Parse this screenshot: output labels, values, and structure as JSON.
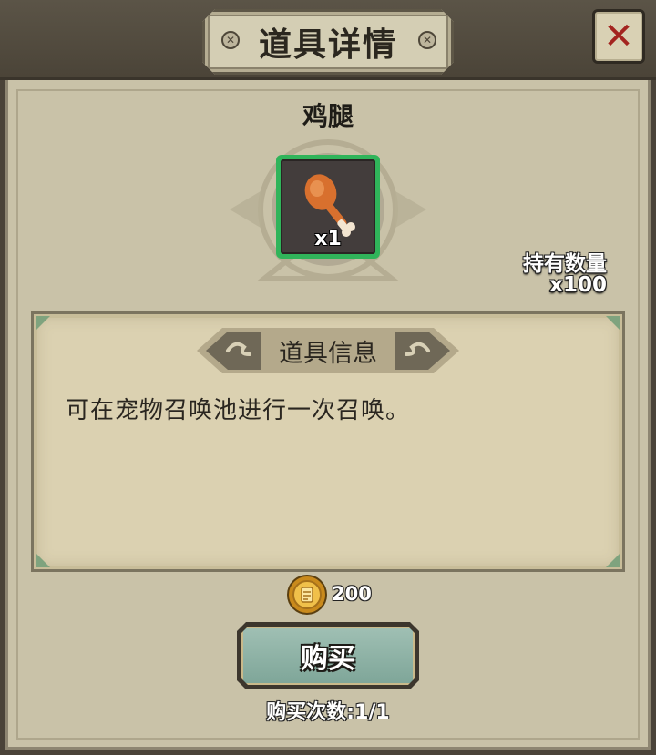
{
  "dialog": {
    "title": "道具详情",
    "close_icon": "close-x-icon"
  },
  "item": {
    "name": "鸡腿",
    "icon": "chicken-leg-icon",
    "quantity_label": "x1",
    "slot_border_color": "#30b45a"
  },
  "owned": {
    "label": "持有数量",
    "value": "x100"
  },
  "info": {
    "header": "道具信息",
    "description": "可在宠物召唤池进行一次召唤。"
  },
  "purchase": {
    "currency_icon": "gold-coin-icon",
    "price": "200",
    "buy_label": "购买",
    "buy_limit": "购买次数:1/1"
  },
  "colors": {
    "panel_bg": "#c9c2a8",
    "frame_dark": "#4a4339",
    "close_x": "#a3241f",
    "button_face": "#8fb3a6"
  }
}
